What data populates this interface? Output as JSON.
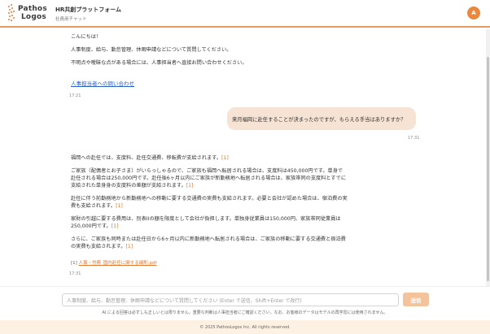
{
  "header": {
    "logo_line1": "Pathos",
    "logo_line2": "Logos",
    "title": "HR共創プラットフォーム",
    "subtitle": "社員用チャット",
    "avatar_letter": "A"
  },
  "chat": {
    "greeting": {
      "lines": [
        "こんにちは！",
        "人事制度、給与、勤怠管理、休暇申請などについて質問してください。",
        "不明点や曖昧な点がある場合には、人事担当者へ直接お問い合わせください。"
      ],
      "contact_link": "人事担当者への問い合わせ",
      "time": "17:21"
    },
    "user_message": {
      "text": "来月福岡に赴任することが決まったのですが、もらえる手当はありますか？",
      "time": "17:31"
    },
    "answer": {
      "p1": "福岡への赴任では、支度料、赴任交通費、移転費が支給されます。",
      "p2": "ご家族（配偶者とお子さま）がいらっしゃるので、ご家族も福岡へ転居される場合は、支度料は450,000円です。単身で赴任される場合は250,000円です。赴任後6ヶ月以内にご家族が新勤務地へ転居される場合は、家族帯同の支度料とすでに支給された単身身の支度料の差額が支給されます。",
      "p3": "赴任に伴う前勤務地から新勤務地への移動に要する交通費の実費も支給されます。必要と会社が認めた場合は、宿泊費の実費も支給されます。",
      "p4": "家財の引越に要する費用は、別表IIの額を限度として会社が負担します。単独身従業員は150,000円、家族帯同従業員は250,000円です。",
      "p5": "さらに、ご家族も同時または赴任日から6ヶ月以内に新勤務地へ転居される場合は、ご家族の移動に要する交通費と宿泊費の実費も支給されます。",
      "cite": "[1]",
      "ref_label": "[1]",
      "ref_link": "人事・労務_国内赴任に関する細則.pdf",
      "time": "17:31"
    }
  },
  "input": {
    "placeholder": "人事制度、給与、勤怠管理、休暇申請などについて質問してください (Enter で送信、Shift+Enter で改行)",
    "send_label": "送信",
    "disclaimer": "AI による回答は必ずしも正しいとは限りません。重要な判断は人事担当者にご確認ください。なお、お客様のデータはモデルの再学習には使用されません。"
  },
  "footer": {
    "copyright": "© 2025 PathosLogos Inc. All rights reserved."
  },
  "colors": {
    "accent": "#e8893f",
    "bubble": "#f7e3d3",
    "link": "#2a62c9",
    "footer_bg": "#fdf1e4"
  }
}
